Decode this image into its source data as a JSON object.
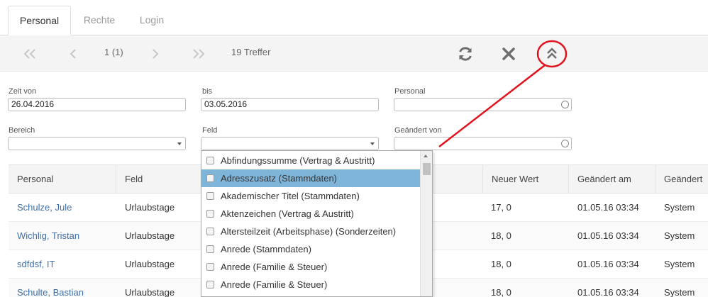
{
  "tabs": [
    {
      "label": "Personal"
    },
    {
      "label": "Rechte"
    },
    {
      "label": "Login"
    }
  ],
  "toolbar": {
    "first_icon": "double-chevron-left-icon",
    "prev_icon": "chevron-left-icon",
    "page_info": "1 (1)",
    "next_icon": "chevron-right-icon",
    "last_icon": "double-chevron-right-icon",
    "hits": "19 Treffer",
    "refresh_icon": "refresh-icon",
    "clear_icon": "close-icon",
    "collapse_icon": "double-chevron-up-icon"
  },
  "filters": {
    "zeit_von": {
      "label": "Zeit von",
      "value": "26.04.2016"
    },
    "bis": {
      "label": "bis",
      "value": "03.05.2016"
    },
    "personal": {
      "label": "Personal",
      "value": ""
    },
    "bereich": {
      "label": "Bereich",
      "value": ""
    },
    "feld": {
      "label": "Feld",
      "value": ""
    },
    "geaendert_von": {
      "label": "Geändert von",
      "value": ""
    }
  },
  "table": {
    "columns": [
      "Personal",
      "Feld",
      "Neuer Wert",
      "Geändert am",
      "Geändert"
    ],
    "rows": [
      {
        "personal": "Schulze, Jule",
        "feld": "Urlaubstage",
        "neuer_wert": "17, 0",
        "geaendert_am": "01.05.16 03:34",
        "geaendert": "System"
      },
      {
        "personal": "Wichlig, Tristan",
        "feld": "Urlaubstage",
        "neuer_wert": "18, 0",
        "geaendert_am": "01.05.16 03:34",
        "geaendert": "System"
      },
      {
        "personal": "sdfdsf, IT",
        "feld": "Urlaubstage",
        "neuer_wert": "18, 0",
        "geaendert_am": "01.05.16 03:34",
        "geaendert": "System"
      },
      {
        "personal": "Schulte, Bastian",
        "feld": "Urlaubstage",
        "neuer_wert": "18, 0",
        "geaendert_am": "01.05.16 03:34",
        "geaendert": "System"
      }
    ]
  },
  "dropdown": {
    "options": [
      "Abfindungssumme (Vertrag & Austritt)",
      "Adresszusatz (Stammdaten)",
      "Akademischer Titel (Stammdaten)",
      "Aktenzeichen (Vertrag & Austritt)",
      "Altersteilzeit (Arbeitsphase) (Sonderzeiten)",
      "Anrede (Stammdaten)",
      "Anrede (Familie & Steuer)",
      "Anrede (Familie & Steuer)"
    ],
    "highlighted_index": 1
  },
  "colors": {
    "highlight": "#7fb5d8",
    "link": "#3f6fa8",
    "annotation": "#e0141e"
  }
}
